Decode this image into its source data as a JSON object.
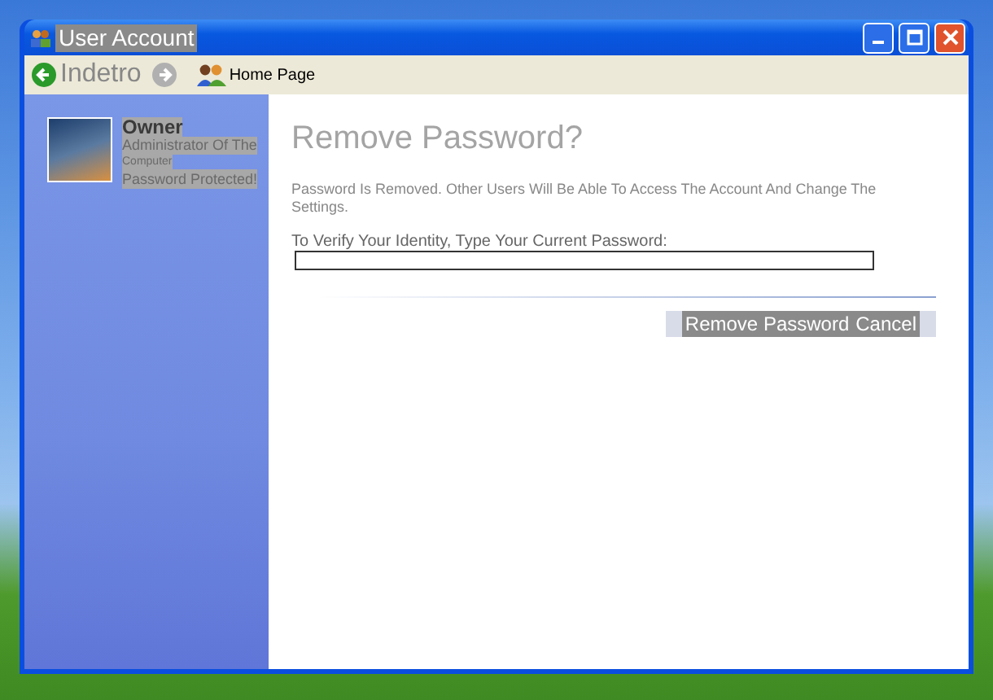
{
  "window": {
    "title": "User Account"
  },
  "toolbar": {
    "back": {
      "label": "Indetro"
    },
    "forward": {
      "disabled": true
    },
    "home": {
      "label": "Home Page"
    }
  },
  "account": {
    "name": "Owner",
    "role": "Administrator Of The",
    "role_continued": "Computer",
    "status": "Password Protected!"
  },
  "page": {
    "heading": "Remove Password?",
    "description": "Password Is Removed. Other Users Will Be Able To Access The Account And Change The Settings.",
    "prompt": "To Verify Your Identity, Type Your Current Password:"
  },
  "buttons": [
    {
      "label": "Remove Password"
    },
    {
      "label": "Cancel"
    }
  ]
}
